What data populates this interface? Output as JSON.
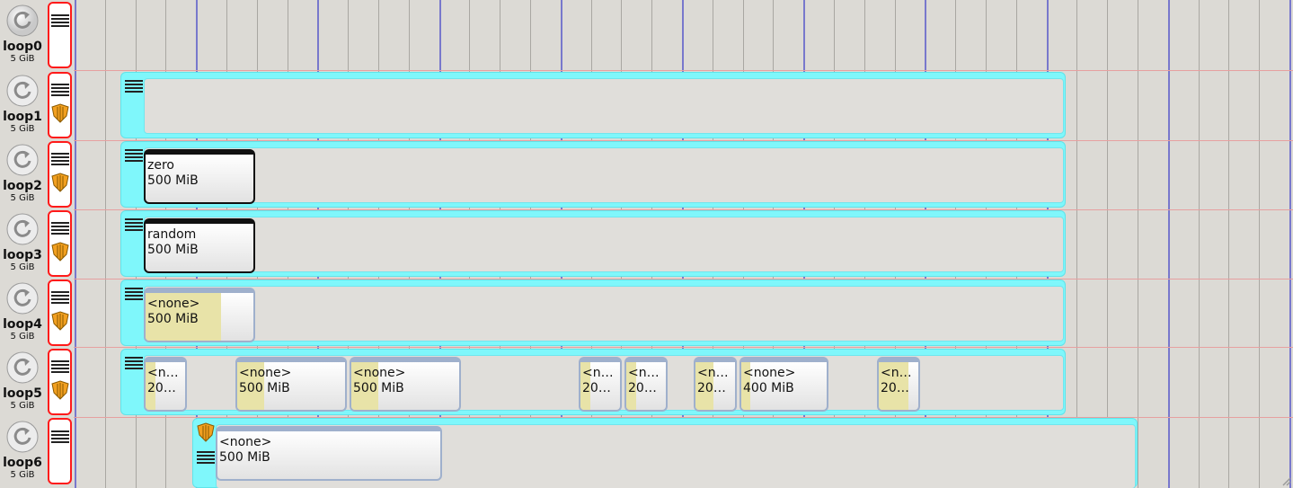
{
  "disks": [
    {
      "name": "loop0",
      "size": "5 GiB"
    },
    {
      "name": "loop1",
      "size": "5 GiB"
    },
    {
      "name": "loop2",
      "size": "5 GiB"
    },
    {
      "name": "loop3",
      "size": "5 GiB"
    },
    {
      "name": "loop4",
      "size": "5 GiB"
    },
    {
      "name": "loop5",
      "size": "5 GiB"
    },
    {
      "name": "loop6",
      "size": "5 GiB"
    }
  ],
  "partitions": {
    "loop2": [
      {
        "name": "zero",
        "size": "500 MiB"
      }
    ],
    "loop3": [
      {
        "name": "random",
        "size": "500 MiB"
      }
    ],
    "loop4": [
      {
        "name": "<none>",
        "size": "500 MiB",
        "usage_fraction": 0.7
      }
    ],
    "loop5": [
      {
        "name": "<n…",
        "size": "20…",
        "usage_fraction": 0.25
      },
      {
        "name": "<none>",
        "size": "500 MiB",
        "usage_fraction": 0.25
      },
      {
        "name": "<none>",
        "size": "500 MiB",
        "usage_fraction": 0.25
      },
      {
        "name": "<n…",
        "size": "20…",
        "usage_fraction": 0.25
      },
      {
        "name": "<n…",
        "size": "20…",
        "usage_fraction": 0.25
      },
      {
        "name": "<n…",
        "size": "20…",
        "usage_fraction": 0.45
      },
      {
        "name": "<none>",
        "size": "400 MiB",
        "usage_fraction": 0.1
      },
      {
        "name": "<n…",
        "size": "20…",
        "usage_fraction": 0.75
      }
    ],
    "loop6": [
      {
        "name": "<none>",
        "size": "500 MiB"
      }
    ]
  },
  "icons": {
    "disk": "refresh-arrow-disk-icon",
    "menu": "hamburger-menu-icon",
    "shield": "encryption-shield-icon"
  },
  "colors": {
    "device_border": "#ff1a1a",
    "container": "#7ff7fb",
    "major_grid": "#7878cc",
    "row_separator": "#e6a0a0",
    "used_fill": "#e8e3a8"
  }
}
